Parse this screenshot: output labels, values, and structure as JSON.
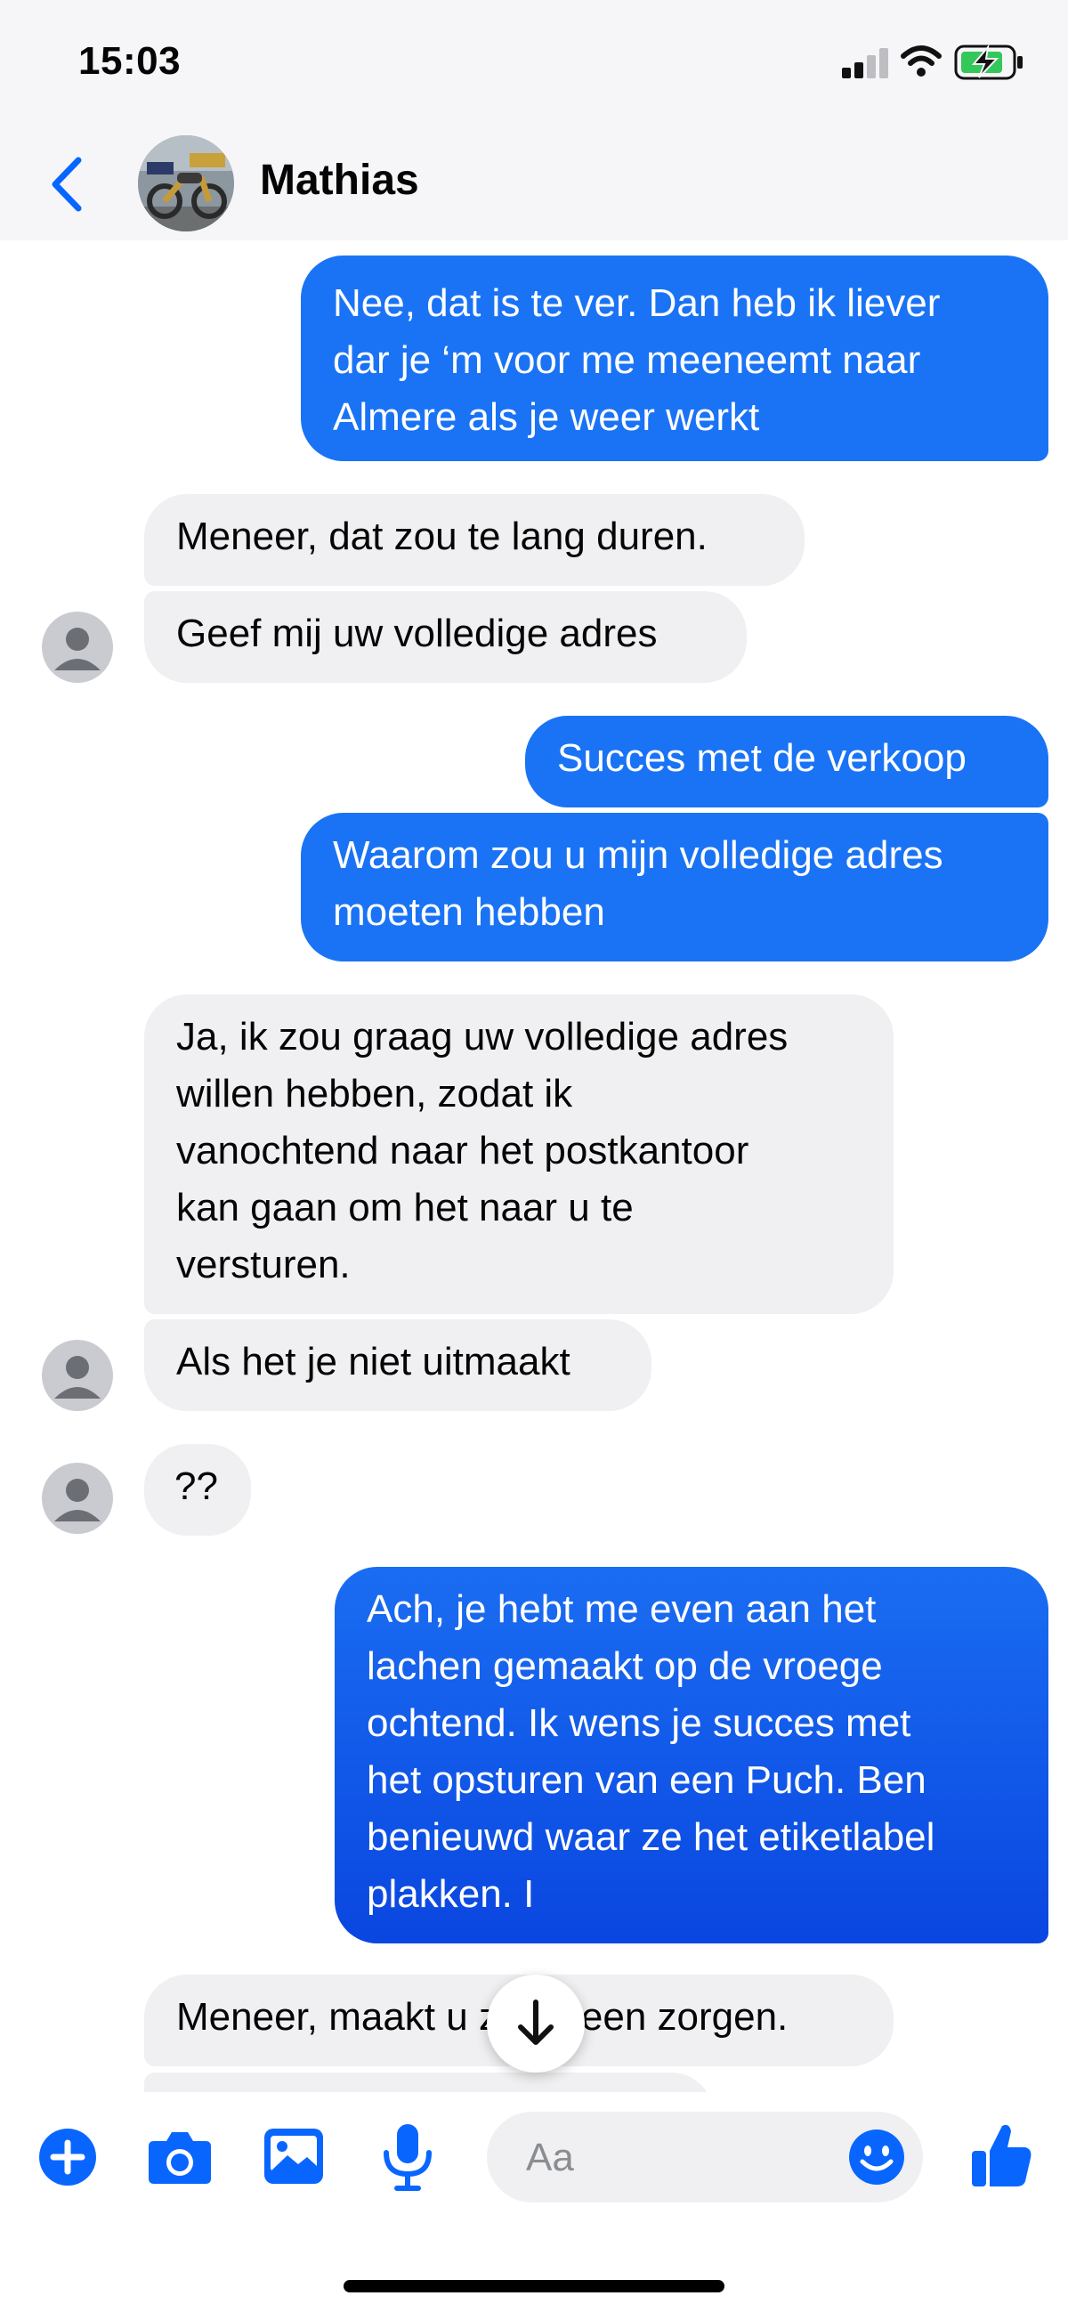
{
  "status_bar": {
    "time": "15:03",
    "battery_charging": true
  },
  "header": {
    "contact_name": "Mathias",
    "back_icon": "chevron-left-icon"
  },
  "messages": [
    {
      "direction": "outgoing",
      "text": "Nee, dat is te ver. Dan heb ik liever\ndar je ‘m voor me meeneemt naar\nAlmere als je weer werkt"
    },
    {
      "direction": "incoming",
      "text": "Meneer, dat zou te lang duren."
    },
    {
      "direction": "incoming",
      "text": "Geef mij uw volledige adres"
    },
    {
      "direction": "outgoing",
      "text": "Succes met de verkoop"
    },
    {
      "direction": "outgoing",
      "text": "Waarom zou u mijn volledige adres\nmoeten hebben"
    },
    {
      "direction": "incoming",
      "text": "Ja, ik zou graag uw volledige adres\nwillen hebben, zodat ik\nvanochtend naar het postkantoor\nkan gaan om het naar u te\nversturen."
    },
    {
      "direction": "incoming",
      "text": "Als het je niet uitmaakt"
    },
    {
      "direction": "incoming",
      "text": "??"
    },
    {
      "direction": "outgoing",
      "text": "Ach, je hebt me even aan het\nlachen gemaakt op de vroege\nochtend. Ik wens je succes met\nhet opsturen van een Puch. Ben\nbenieuwd waar ze het etiketlabel\nplakken. I"
    },
    {
      "direction": "incoming",
      "text": "Meneer, maakt u zich geen zorgen."
    }
  ],
  "composer": {
    "placeholder": "Aa",
    "icons": [
      "plus-icon",
      "camera-icon",
      "gallery-icon",
      "microphone-icon",
      "emoji-icon",
      "thumbs-up-icon"
    ]
  },
  "colors": {
    "outgoing_bubble": "#1a73f5",
    "outgoing_bubble_deep": "#0a46e0",
    "incoming_bubble": "#f0f0f2",
    "accent": "#0866ff"
  }
}
